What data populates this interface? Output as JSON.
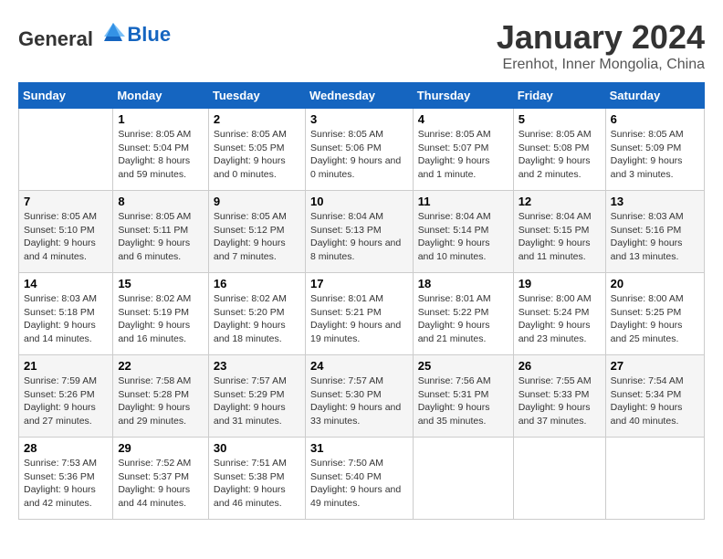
{
  "header": {
    "logo_general": "General",
    "logo_blue": "Blue",
    "title": "January 2024",
    "subtitle": "Erenhot, Inner Mongolia, China"
  },
  "columns": [
    "Sunday",
    "Monday",
    "Tuesday",
    "Wednesday",
    "Thursday",
    "Friday",
    "Saturday"
  ],
  "weeks": [
    [
      {
        "day": "",
        "sunrise": "",
        "sunset": "",
        "daylight": ""
      },
      {
        "day": "1",
        "sunrise": "Sunrise: 8:05 AM",
        "sunset": "Sunset: 5:04 PM",
        "daylight": "Daylight: 8 hours and 59 minutes."
      },
      {
        "day": "2",
        "sunrise": "Sunrise: 8:05 AM",
        "sunset": "Sunset: 5:05 PM",
        "daylight": "Daylight: 9 hours and 0 minutes."
      },
      {
        "day": "3",
        "sunrise": "Sunrise: 8:05 AM",
        "sunset": "Sunset: 5:06 PM",
        "daylight": "Daylight: 9 hours and 0 minutes."
      },
      {
        "day": "4",
        "sunrise": "Sunrise: 8:05 AM",
        "sunset": "Sunset: 5:07 PM",
        "daylight": "Daylight: 9 hours and 1 minute."
      },
      {
        "day": "5",
        "sunrise": "Sunrise: 8:05 AM",
        "sunset": "Sunset: 5:08 PM",
        "daylight": "Daylight: 9 hours and 2 minutes."
      },
      {
        "day": "6",
        "sunrise": "Sunrise: 8:05 AM",
        "sunset": "Sunset: 5:09 PM",
        "daylight": "Daylight: 9 hours and 3 minutes."
      }
    ],
    [
      {
        "day": "7",
        "sunrise": "Sunrise: 8:05 AM",
        "sunset": "Sunset: 5:10 PM",
        "daylight": "Daylight: 9 hours and 4 minutes."
      },
      {
        "day": "8",
        "sunrise": "Sunrise: 8:05 AM",
        "sunset": "Sunset: 5:11 PM",
        "daylight": "Daylight: 9 hours and 6 minutes."
      },
      {
        "day": "9",
        "sunrise": "Sunrise: 8:05 AM",
        "sunset": "Sunset: 5:12 PM",
        "daylight": "Daylight: 9 hours and 7 minutes."
      },
      {
        "day": "10",
        "sunrise": "Sunrise: 8:04 AM",
        "sunset": "Sunset: 5:13 PM",
        "daylight": "Daylight: 9 hours and 8 minutes."
      },
      {
        "day": "11",
        "sunrise": "Sunrise: 8:04 AM",
        "sunset": "Sunset: 5:14 PM",
        "daylight": "Daylight: 9 hours and 10 minutes."
      },
      {
        "day": "12",
        "sunrise": "Sunrise: 8:04 AM",
        "sunset": "Sunset: 5:15 PM",
        "daylight": "Daylight: 9 hours and 11 minutes."
      },
      {
        "day": "13",
        "sunrise": "Sunrise: 8:03 AM",
        "sunset": "Sunset: 5:16 PM",
        "daylight": "Daylight: 9 hours and 13 minutes."
      }
    ],
    [
      {
        "day": "14",
        "sunrise": "Sunrise: 8:03 AM",
        "sunset": "Sunset: 5:18 PM",
        "daylight": "Daylight: 9 hours and 14 minutes."
      },
      {
        "day": "15",
        "sunrise": "Sunrise: 8:02 AM",
        "sunset": "Sunset: 5:19 PM",
        "daylight": "Daylight: 9 hours and 16 minutes."
      },
      {
        "day": "16",
        "sunrise": "Sunrise: 8:02 AM",
        "sunset": "Sunset: 5:20 PM",
        "daylight": "Daylight: 9 hours and 18 minutes."
      },
      {
        "day": "17",
        "sunrise": "Sunrise: 8:01 AM",
        "sunset": "Sunset: 5:21 PM",
        "daylight": "Daylight: 9 hours and 19 minutes."
      },
      {
        "day": "18",
        "sunrise": "Sunrise: 8:01 AM",
        "sunset": "Sunset: 5:22 PM",
        "daylight": "Daylight: 9 hours and 21 minutes."
      },
      {
        "day": "19",
        "sunrise": "Sunrise: 8:00 AM",
        "sunset": "Sunset: 5:24 PM",
        "daylight": "Daylight: 9 hours and 23 minutes."
      },
      {
        "day": "20",
        "sunrise": "Sunrise: 8:00 AM",
        "sunset": "Sunset: 5:25 PM",
        "daylight": "Daylight: 9 hours and 25 minutes."
      }
    ],
    [
      {
        "day": "21",
        "sunrise": "Sunrise: 7:59 AM",
        "sunset": "Sunset: 5:26 PM",
        "daylight": "Daylight: 9 hours and 27 minutes."
      },
      {
        "day": "22",
        "sunrise": "Sunrise: 7:58 AM",
        "sunset": "Sunset: 5:28 PM",
        "daylight": "Daylight: 9 hours and 29 minutes."
      },
      {
        "day": "23",
        "sunrise": "Sunrise: 7:57 AM",
        "sunset": "Sunset: 5:29 PM",
        "daylight": "Daylight: 9 hours and 31 minutes."
      },
      {
        "day": "24",
        "sunrise": "Sunrise: 7:57 AM",
        "sunset": "Sunset: 5:30 PM",
        "daylight": "Daylight: 9 hours and 33 minutes."
      },
      {
        "day": "25",
        "sunrise": "Sunrise: 7:56 AM",
        "sunset": "Sunset: 5:31 PM",
        "daylight": "Daylight: 9 hours and 35 minutes."
      },
      {
        "day": "26",
        "sunrise": "Sunrise: 7:55 AM",
        "sunset": "Sunset: 5:33 PM",
        "daylight": "Daylight: 9 hours and 37 minutes."
      },
      {
        "day": "27",
        "sunrise": "Sunrise: 7:54 AM",
        "sunset": "Sunset: 5:34 PM",
        "daylight": "Daylight: 9 hours and 40 minutes."
      }
    ],
    [
      {
        "day": "28",
        "sunrise": "Sunrise: 7:53 AM",
        "sunset": "Sunset: 5:36 PM",
        "daylight": "Daylight: 9 hours and 42 minutes."
      },
      {
        "day": "29",
        "sunrise": "Sunrise: 7:52 AM",
        "sunset": "Sunset: 5:37 PM",
        "daylight": "Daylight: 9 hours and 44 minutes."
      },
      {
        "day": "30",
        "sunrise": "Sunrise: 7:51 AM",
        "sunset": "Sunset: 5:38 PM",
        "daylight": "Daylight: 9 hours and 46 minutes."
      },
      {
        "day": "31",
        "sunrise": "Sunrise: 7:50 AM",
        "sunset": "Sunset: 5:40 PM",
        "daylight": "Daylight: 9 hours and 49 minutes."
      },
      {
        "day": "",
        "sunrise": "",
        "sunset": "",
        "daylight": ""
      },
      {
        "day": "",
        "sunrise": "",
        "sunset": "",
        "daylight": ""
      },
      {
        "day": "",
        "sunrise": "",
        "sunset": "",
        "daylight": ""
      }
    ]
  ]
}
